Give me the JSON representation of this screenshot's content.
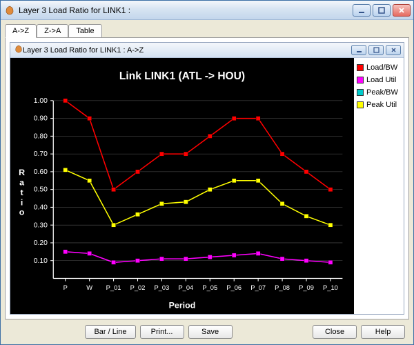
{
  "window": {
    "title": "Layer 3 Load Ratio for LINK1 :"
  },
  "tabs": [
    {
      "label": "A->Z",
      "active": true
    },
    {
      "label": "Z->A",
      "active": false
    },
    {
      "label": "Table",
      "active": false
    }
  ],
  "inner_window": {
    "title": "Layer 3 Load Ratio for LINK1 : A->Z"
  },
  "buttons": {
    "barline": "Bar / Line",
    "print": "Print...",
    "save": "Save",
    "close": "Close",
    "help": "Help"
  },
  "legend": [
    {
      "name": "Load/BW",
      "color": "#ff0000"
    },
    {
      "name": "Load Util",
      "color": "#ff00ff"
    },
    {
      "name": "Peak/BW",
      "color": "#00cccc"
    },
    {
      "name": "Peak Util",
      "color": "#ffff00"
    }
  ],
  "chart_data": {
    "type": "line",
    "title": "Link LINK1 (ATL -> HOU)",
    "xlabel": "Period",
    "ylabel": "Ratio",
    "categories": [
      "P",
      "W",
      "P_01",
      "P_02",
      "P_03",
      "P_04",
      "P_05",
      "P_06",
      "P_07",
      "P_08",
      "P_09",
      "P_10"
    ],
    "ylim": [
      0,
      1.0
    ],
    "yticks": [
      0.1,
      0.2,
      0.3,
      0.4,
      0.5,
      0.6,
      0.7,
      0.8,
      0.9,
      1.0
    ],
    "grid": true,
    "legend_position": "right",
    "series": [
      {
        "name": "Load/BW",
        "color": "#ff0000",
        "values": [
          1.0,
          0.9,
          0.5,
          0.6,
          0.7,
          0.7,
          0.8,
          0.9,
          0.9,
          0.7,
          0.6,
          0.5
        ]
      },
      {
        "name": "Peak Util",
        "color": "#ffff00",
        "values": [
          0.61,
          0.55,
          0.3,
          0.36,
          0.42,
          0.43,
          0.5,
          0.55,
          0.55,
          0.42,
          0.35,
          0.3
        ]
      },
      {
        "name": "Load Util",
        "color": "#ff00ff",
        "values": [
          0.15,
          0.14,
          0.09,
          0.1,
          0.11,
          0.11,
          0.12,
          0.13,
          0.14,
          0.11,
          0.1,
          0.09
        ]
      }
    ]
  }
}
